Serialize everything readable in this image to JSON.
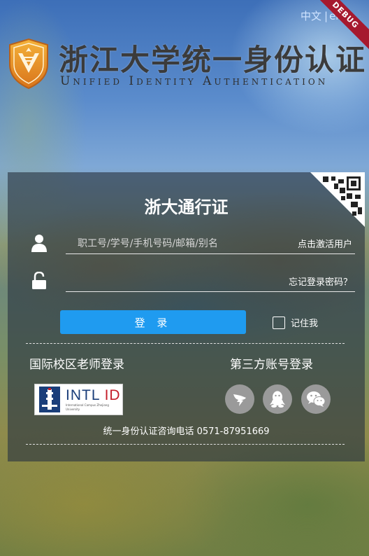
{
  "header": {
    "lang_cn": "中文",
    "lang_sep": "|",
    "lang_en": "eng",
    "debug": "DEBUG",
    "title_cn": "浙江大学统一身份认证",
    "title_en": "Unified Identity Authentication"
  },
  "login": {
    "title": "浙大通行证",
    "username_placeholder": "职工号/学号/手机号码/邮箱/别名",
    "username_value": "",
    "password_value": "",
    "activate_link": "点击激活用户",
    "forgot_link": "忘记登录密码？",
    "submit_label": "登 录",
    "remember_label": "记住我",
    "remember_checked": false
  },
  "alt_login": {
    "intl_title": "国际校区老师登录",
    "intl_badge_prefix": "INTL",
    "intl_badge_suffix": "ID",
    "intl_badge_sub": "International Campus Zhejiang University",
    "third_party_title": "第三方账号登录",
    "providers": [
      "dingtalk-icon",
      "qq-icon",
      "wechat-icon"
    ]
  },
  "footer": {
    "hotline": "统一身份认证咨询电话 0571-87951669"
  },
  "colors": {
    "accent": "#1f9bf0",
    "panel": "rgba(40,52,64,0.62)",
    "debug": "#a6192e",
    "logo_orange": "#e8891c"
  }
}
